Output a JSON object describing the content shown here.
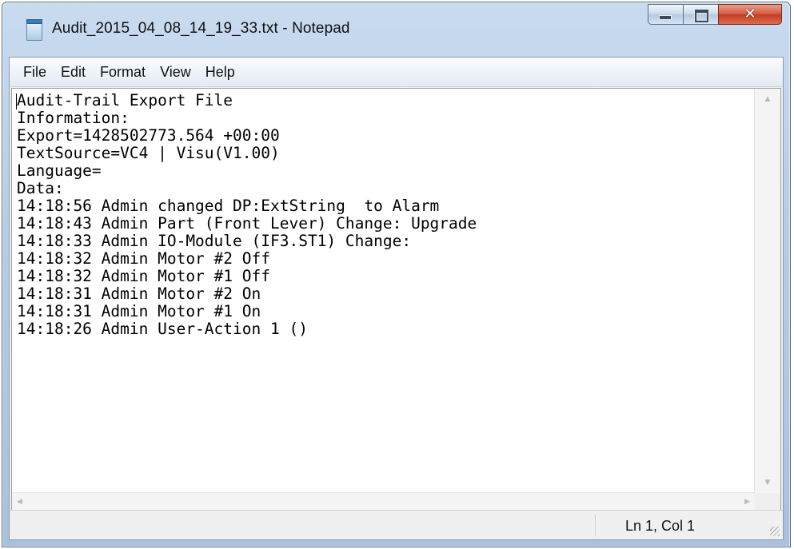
{
  "window": {
    "title": "Audit_2015_04_08_14_19_33.txt - Notepad",
    "app_icon": "notepad-icon"
  },
  "caption_buttons": {
    "minimize_icon": "minimize-icon",
    "maximize_icon": "maximize-icon",
    "close_glyph": "✕"
  },
  "menu": {
    "items": [
      "File",
      "Edit",
      "Format",
      "View",
      "Help"
    ]
  },
  "document": {
    "lines": [
      "Audit-Trail Export File",
      "Information:",
      "Export=1428502773.564 +00:00",
      "TextSource=VC4 | Visu(V1.00)",
      "Language=",
      "Data:",
      "14:18:56 Admin changed DP:ExtString  to Alarm",
      "14:18:43 Admin Part (Front Lever) Change: Upgrade",
      "14:18:33 Admin IO-Module (IF3.ST1) Change:",
      "14:18:32 Admin Motor #2 Off",
      "14:18:32 Admin Motor #1 Off",
      "14:18:31 Admin Motor #2 On",
      "14:18:31 Admin Motor #1 On",
      "14:18:26 Admin User-Action 1 ()"
    ]
  },
  "status": {
    "position": "Ln 1, Col 1"
  },
  "colors": {
    "titlebar": "#b7cde6",
    "close_button": "#c23b22",
    "editor_bg": "#ffffff"
  }
}
